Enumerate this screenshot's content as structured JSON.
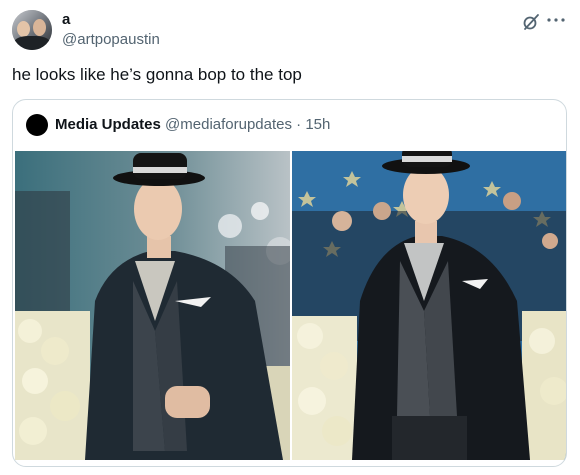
{
  "author": {
    "display_name": "a",
    "handle": "@artpopaustin"
  },
  "tweet": {
    "text": "he looks like he’s gonna bop to the top"
  },
  "quoted_tweet": {
    "display_name": "Media Updates",
    "handle": "@mediaforupdates",
    "separator": "·",
    "time": "15h"
  },
  "icons": {
    "grok": "grok-icon",
    "more": "more-options-icon",
    "avatar": "profile-avatar"
  },
  "colors": {
    "text_primary": "#0f1419",
    "text_secondary": "#536471",
    "border": "#cfd9de"
  }
}
